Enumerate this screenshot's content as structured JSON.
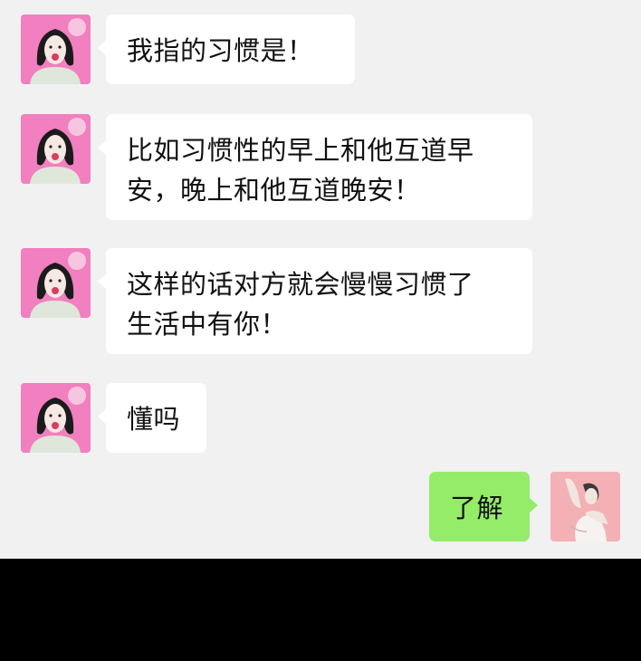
{
  "messages": [
    {
      "sender": "contact",
      "text": "我指的习惯是！"
    },
    {
      "sender": "contact",
      "text": "比如习惯性的早上和他互道早\n安，晚上和他互道晚安！"
    },
    {
      "sender": "contact",
      "text": "这样的话对方就会慢慢习惯了\n生活中有你！"
    },
    {
      "sender": "contact",
      "text": "懂吗"
    },
    {
      "sender": "me",
      "text": "了解"
    }
  ],
  "colors": {
    "chat_background": "#f1f1f1",
    "incoming_bubble": "#ffffff",
    "outgoing_bubble": "#95ec69",
    "contact_avatar_bg": "#f27fbf",
    "my_avatar_bg": "#f3b1b6"
  },
  "icons": {
    "contact_avatar": "woman-blowing-bubble-avatar",
    "my_avatar": "woman-raising-arm-avatar"
  }
}
